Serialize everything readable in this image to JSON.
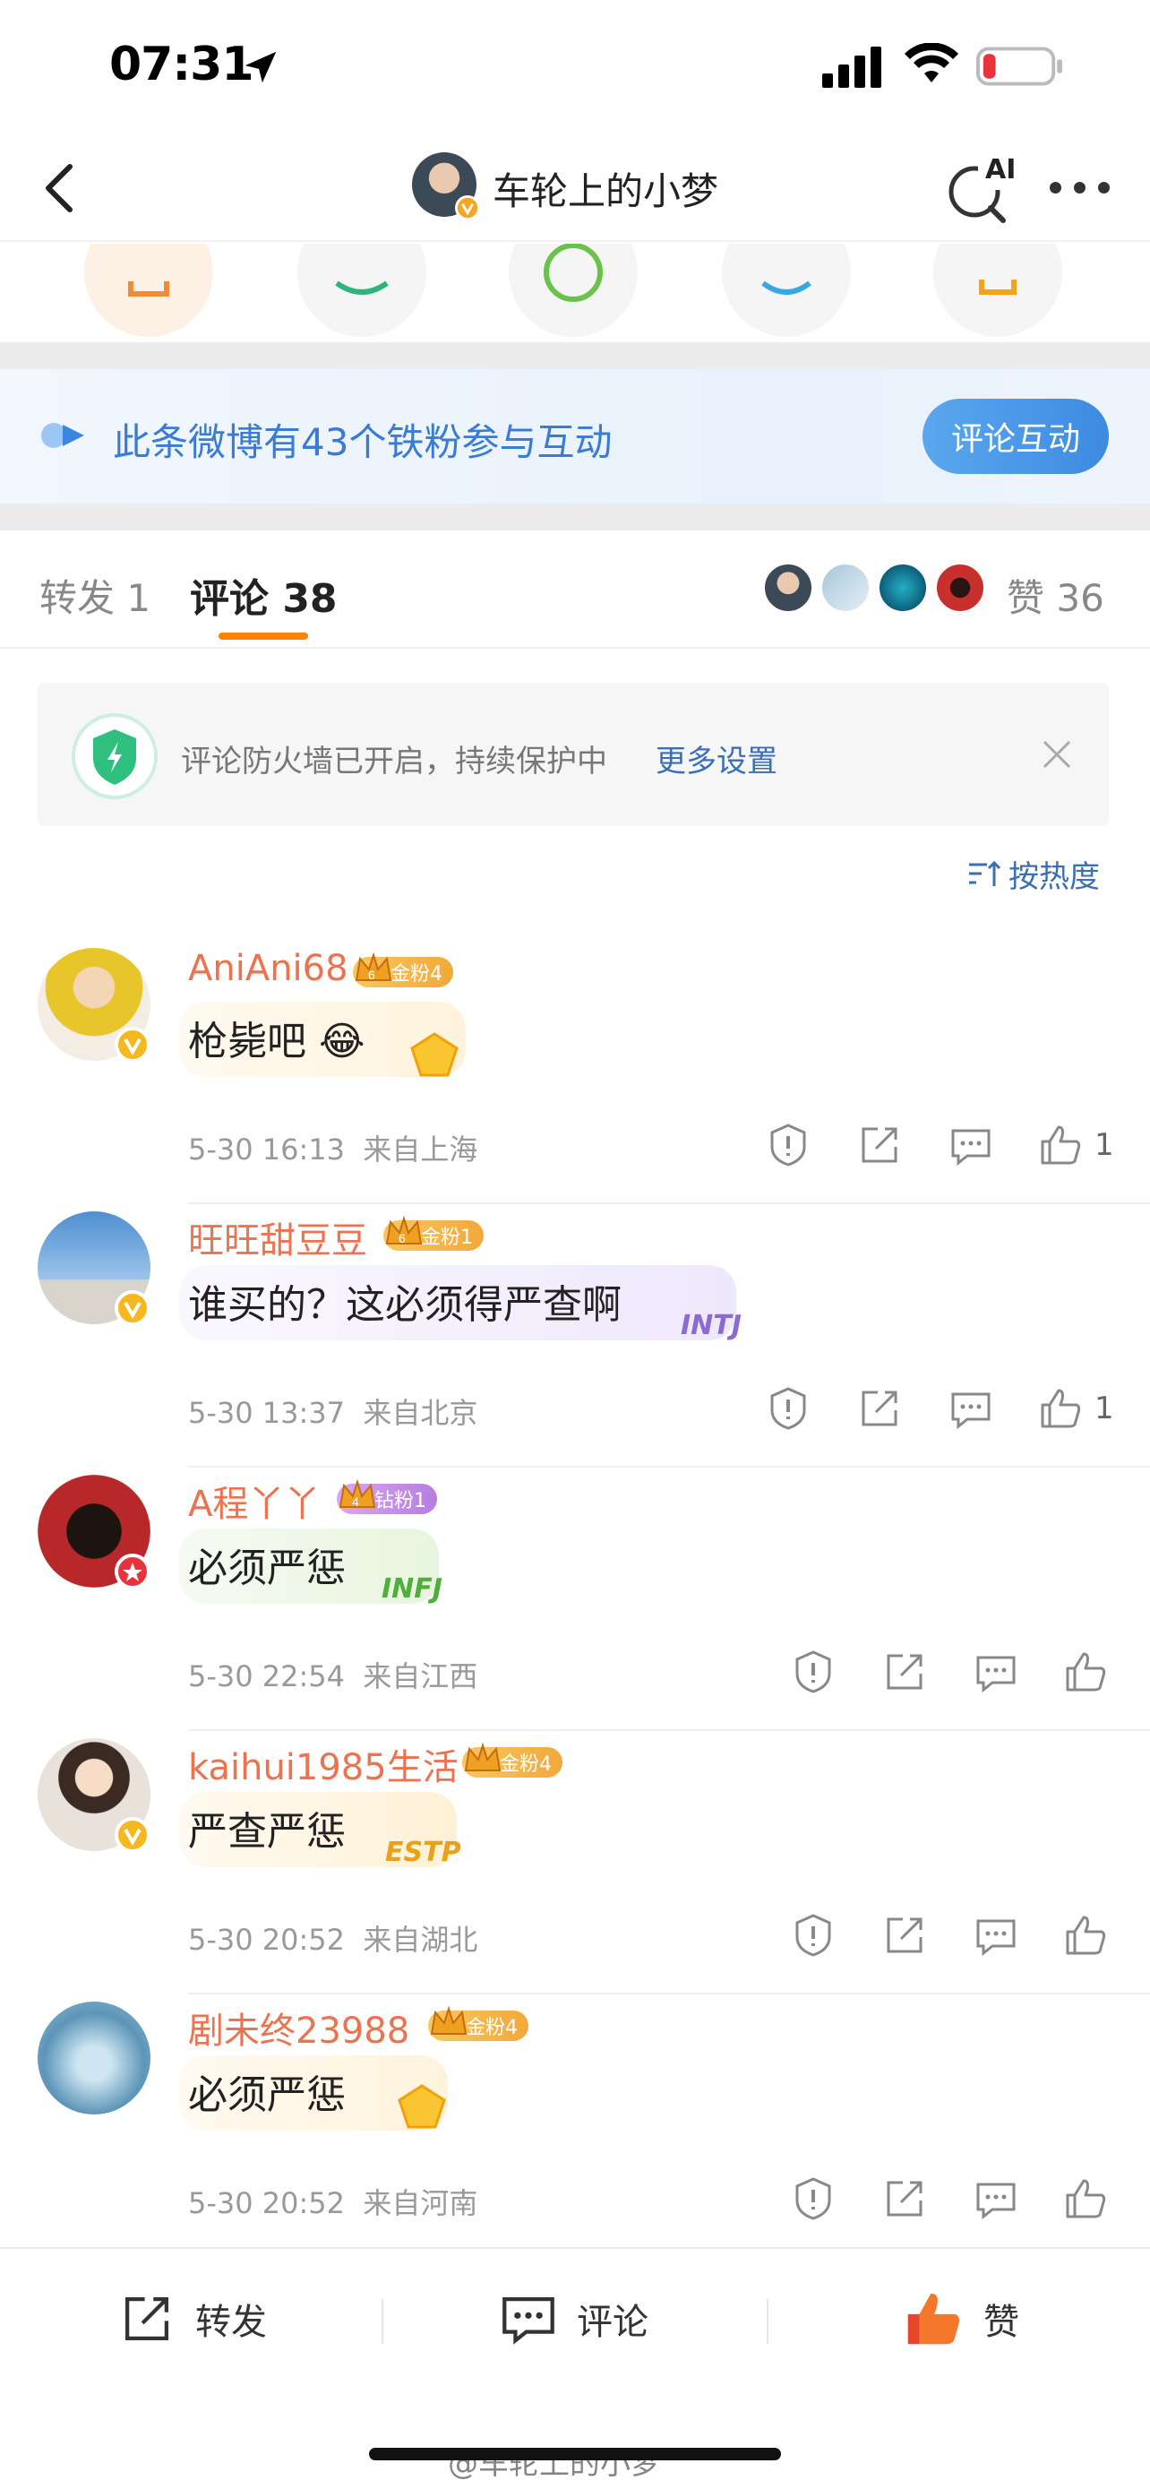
{
  "status_bar": {
    "time": "07:31"
  },
  "nav": {
    "title": "车轮上的小梦",
    "ai_label": "AI"
  },
  "fans_banner": {
    "text": "此条微博有43个铁粉参与互动",
    "button": "评论互动"
  },
  "tabs": {
    "repost": "转发 1",
    "comment": "评论 38",
    "like": "赞 36"
  },
  "firewall": {
    "text": "评论防火墙已开启，持续保护中",
    "link": "更多设置"
  },
  "sort": {
    "label": "按热度"
  },
  "comments": [
    {
      "name": "AniAni68",
      "badge": "金粉4",
      "badge_level": "6",
      "text": "枪毙吧",
      "time": "5-30 16:13",
      "location": "来自上海",
      "likes": "1"
    },
    {
      "name": "旺旺甜豆豆",
      "badge": "金粉1",
      "badge_level": "6",
      "text": "谁买的？这必须得严查啊",
      "time": "5-30 13:37",
      "location": "来自北京",
      "likes": "1",
      "tag": "INTJ"
    },
    {
      "name": "A程丫丫",
      "badge": "钻粉1",
      "badge_level": "4",
      "text": "必须严惩",
      "time": "5-30 22:54",
      "location": "来自江西",
      "likes": "",
      "tag": "INFJ"
    },
    {
      "name": "kaihui1985生活",
      "badge": "金粉4",
      "badge_level": "",
      "text": "严查严惩",
      "time": "5-30 20:52",
      "location": "来自湖北",
      "likes": "",
      "tag": "ESTP"
    },
    {
      "name": "剧未终23988",
      "badge": "金粉4",
      "badge_level": "",
      "text": "必须严惩",
      "time": "5-30 20:52",
      "location": "来自河南",
      "likes": ""
    }
  ],
  "bottom_bar": {
    "repost": "转发",
    "comment": "评论",
    "like": "赞"
  },
  "watermark": "@车轮上的小梦",
  "colors": {
    "accent": "#ff8200",
    "username": "#eb7350",
    "link": "#3a6fb5",
    "gold_badge": "#f5b94a",
    "diamond_badge": "#c58be8"
  }
}
